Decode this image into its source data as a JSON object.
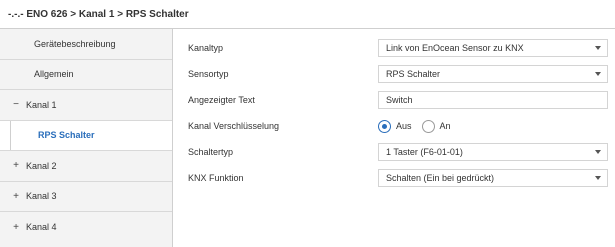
{
  "title": "-.-.- ENO 626 > Kanal 1 > RPS Schalter",
  "sidebar": {
    "items": [
      {
        "label": "Gerätebeschreibung",
        "symbol": ""
      },
      {
        "label": "Allgemein",
        "symbol": ""
      },
      {
        "label": "Kanal 1",
        "symbol": "−"
      },
      {
        "label": "RPS Schalter",
        "symbol": ""
      },
      {
        "label": "Kanal 2",
        "symbol": "+"
      },
      {
        "label": "Kanal 3",
        "symbol": "+"
      },
      {
        "label": "Kanal 4",
        "symbol": "+"
      }
    ],
    "active_index": 3
  },
  "params": {
    "kanaltyp": {
      "label": "Kanaltyp",
      "value": "Link von EnOcean Sensor zu KNX"
    },
    "sensortyp": {
      "label": "Sensortyp",
      "value": "RPS Schalter"
    },
    "text": {
      "label": "Angezeigter Text",
      "value": "Switch"
    },
    "verschluesselung": {
      "label": "Kanal Verschlüsselung",
      "options": [
        "Aus",
        "An"
      ],
      "selected": "Aus"
    },
    "schaltertyp": {
      "label": "Schaltertyp",
      "value": "1 Taster (F6-01-01)"
    },
    "knx_funktion": {
      "label": "KNX Funktion",
      "value": "Schalten (Ein bei gedrückt)"
    }
  },
  "colors": {
    "accent": "#2a6ebb",
    "sidebar_bg": "#f3f3f3",
    "border": "#cfcfcf"
  }
}
